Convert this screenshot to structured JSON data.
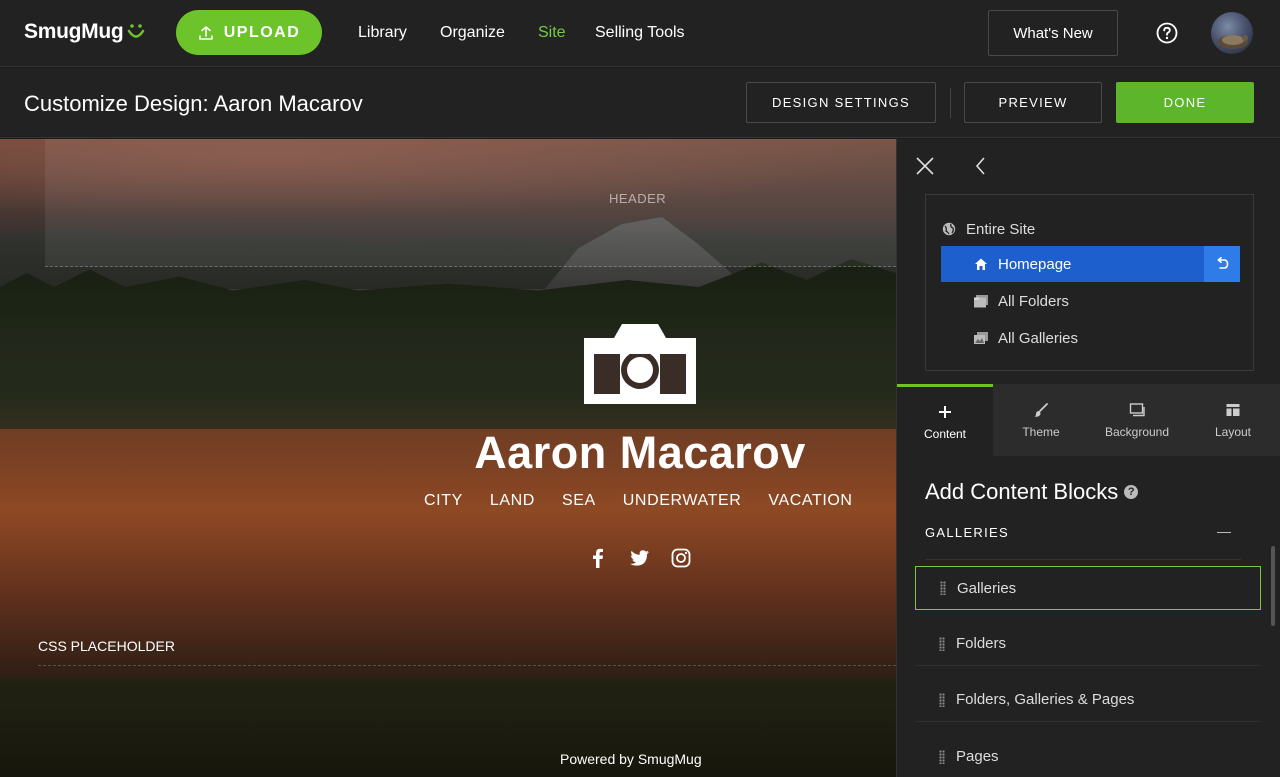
{
  "topnav": {
    "logo": "SmugMug",
    "upload_label": "UPLOAD",
    "links": [
      "Library",
      "Organize",
      "Site",
      "Selling Tools"
    ],
    "active_link": "Site",
    "whats_new": "What's New"
  },
  "subheader": {
    "title": "Customize Design: Aaron Macarov",
    "design_settings": "DESIGN SETTINGS",
    "preview": "PREVIEW",
    "done": "DONE"
  },
  "preview": {
    "header_label": "HEADER",
    "site_name": "Aaron Macarov",
    "menu": [
      "CITY",
      "LAND",
      "SEA",
      "UNDERWATER",
      "VACATION"
    ],
    "social_icons": [
      "facebook-icon",
      "twitter-icon",
      "instagram-icon"
    ],
    "css_placeholder": "CSS PLACEHOLDER",
    "powered_by": "Powered by SmugMug"
  },
  "panel": {
    "scope": [
      {
        "label": "Entire Site",
        "icon": "globe-icon",
        "selected": false
      },
      {
        "label": "Homepage",
        "icon": "home-icon",
        "selected": true
      },
      {
        "label": "All Folders",
        "icon": "folders-icon",
        "selected": false
      },
      {
        "label": "All Galleries",
        "icon": "galleries-icon",
        "selected": false
      }
    ],
    "tabs": [
      {
        "label": "Content",
        "icon": "plus-icon",
        "active": true
      },
      {
        "label": "Theme",
        "icon": "brush-icon",
        "active": false
      },
      {
        "label": "Background",
        "icon": "background-icon",
        "active": false
      },
      {
        "label": "Layout",
        "icon": "layout-icon",
        "active": false
      }
    ],
    "add_title": "Add Content Blocks",
    "section": "GALLERIES",
    "blocks": [
      "Galleries",
      "Folders",
      "Folders, Galleries & Pages",
      "Pages"
    ]
  },
  "colors": {
    "accent_green": "#6dc32a",
    "selected_blue": "#1e5fce",
    "active_nav": "#7ac943"
  }
}
